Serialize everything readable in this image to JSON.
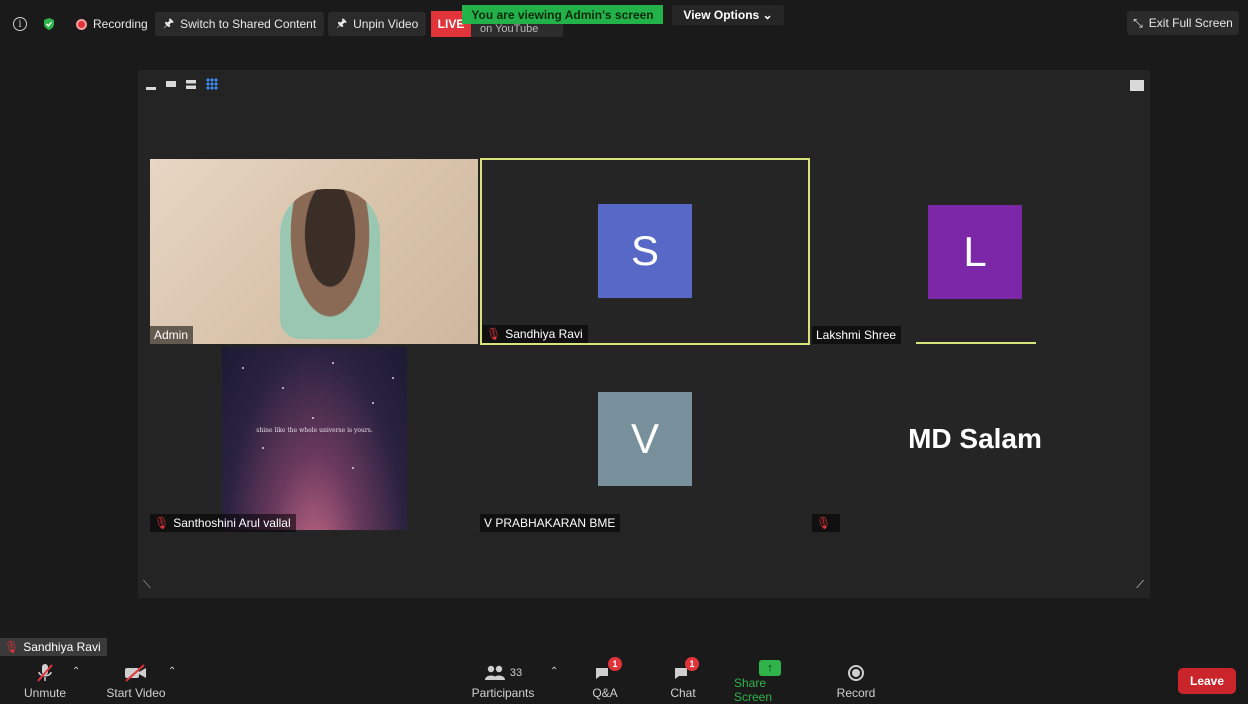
{
  "topbar": {
    "recording_label": "Recording",
    "switch_label": "Switch to Shared Content",
    "unpin_label": "Unpin Video",
    "live_label": "LIVE",
    "youtube_label": "on YouTube",
    "viewing_banner": "You are viewing Admin's screen",
    "view_options_label": "View Options ⌄",
    "exit_fullscreen_label": "Exit Full Screen"
  },
  "tiles": [
    {
      "name": "Admin",
      "type": "video",
      "muted": false
    },
    {
      "name": "Sandhiya Ravi",
      "initial": "S",
      "color": "#5868c6",
      "muted": true,
      "active": true
    },
    {
      "name": "Lakshmi Shree",
      "initial": "L",
      "color": "#7b27a8",
      "muted": false
    },
    {
      "name": "Santhoshini Arul vallal",
      "type": "image",
      "quote": "shine like the whole universe is yours.",
      "muted": true
    },
    {
      "name": "V PRABHAKARAN BME",
      "initial": "V",
      "color": "#78909c",
      "muted": false
    },
    {
      "name": "MD Salam",
      "type": "name",
      "muted": true
    }
  ],
  "self_view": {
    "name": "Sandhiya Ravi"
  },
  "toolbar": {
    "unmute": "Unmute",
    "start_video": "Start Video",
    "participants": "Participants",
    "participants_count": "33",
    "qa": "Q&A",
    "qa_badge": "1",
    "chat": "Chat",
    "chat_badge": "1",
    "share_screen": "Share Screen",
    "record": "Record",
    "leave": "Leave"
  },
  "colors": {
    "accent_green": "#23b24a",
    "live_red": "#e0333a",
    "active_border": "#d8e37a",
    "leave_red": "#c9252b"
  }
}
